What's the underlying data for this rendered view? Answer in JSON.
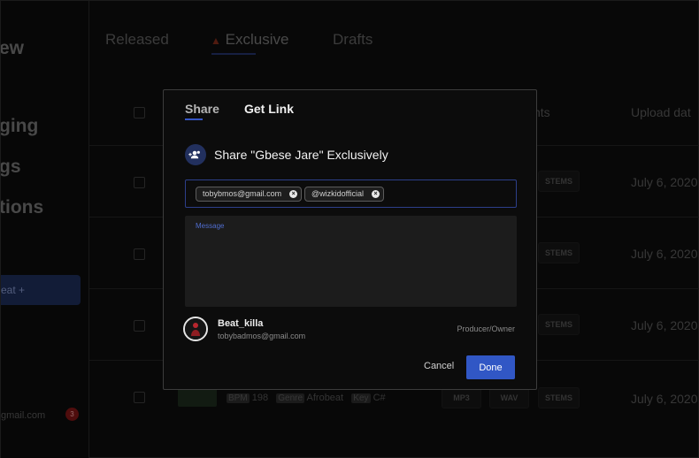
{
  "sidebar": {
    "heading_fragment": "ew",
    "items": [
      "ging",
      "gs",
      "tions"
    ],
    "upload_label": "eat +",
    "email_fragment": "gmail.com",
    "notification_count": "3"
  },
  "tabs": [
    {
      "label": "Released"
    },
    {
      "label": "Exclusive"
    },
    {
      "label": "Drafts"
    }
  ],
  "table": {
    "headers": [
      "nts",
      "Upload dat"
    ],
    "rows": [
      {
        "stems": "STEMS",
        "date": "July 6, 2020"
      },
      {
        "stems": "STEMS",
        "date": "July 6, 2020"
      },
      {
        "stems": "STEMS",
        "date": "July 6, 2020"
      },
      {
        "mp3": "MP3",
        "wav": "WAV",
        "stems": "STEMS",
        "date": "July 6, 2020",
        "bpm_label": "BPM",
        "bpm": "198",
        "genre_label": "Genre",
        "genre": "Afrobeat",
        "key_label": "Key",
        "key": "C#"
      }
    ]
  },
  "modal": {
    "tab_share": "Share",
    "tab_get_link": "Get Link",
    "title": "Share \"Gbese Jare\" Exclusively",
    "recipients": [
      "tobybmos@gmail.com",
      "@wizkidofficial"
    ],
    "message_label": "Message",
    "message_value": "",
    "user": {
      "name": "Beat_killa",
      "email": "tobybadmos@gmail.com",
      "role": "Producer/Owner"
    },
    "cancel_label": "Cancel",
    "done_label": "Done"
  },
  "colors": {
    "accent": "#3157c5",
    "overlay_bg": "#0c0c0c",
    "message_bg": "#1c1c1c"
  }
}
